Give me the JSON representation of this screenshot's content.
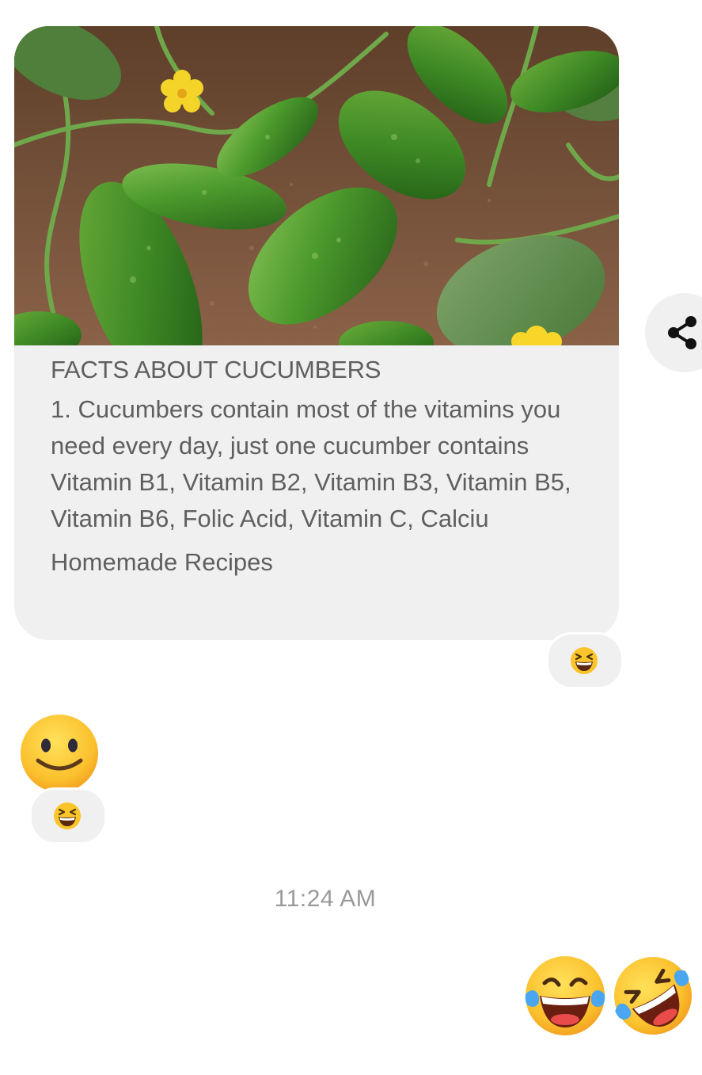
{
  "card": {
    "image_alt": "cucumbers-photo",
    "title": "FACTS ABOUT CUCUMBERS",
    "description": "1. Cucumbers contain most of the vitamins you need every day, just one cucumber contains Vitamin B1, Vitamin B2, Vitamin B3, Vitamin B5, Vitamin B6, Folic Acid, Vitamin C, Calciu",
    "source": "Homemade Recipes"
  },
  "share_icon": "share-icon",
  "reactions": [
    {
      "icon": "grinning-squinting-face-icon"
    },
    {
      "icon": "grinning-squinting-face-icon"
    }
  ],
  "received_emoji": "slightly-smiling-face-icon",
  "timestamp": "11:24 AM",
  "sent_emojis": [
    "face-with-tears-of-joy-icon",
    "rolling-on-floor-laughing-icon"
  ]
}
